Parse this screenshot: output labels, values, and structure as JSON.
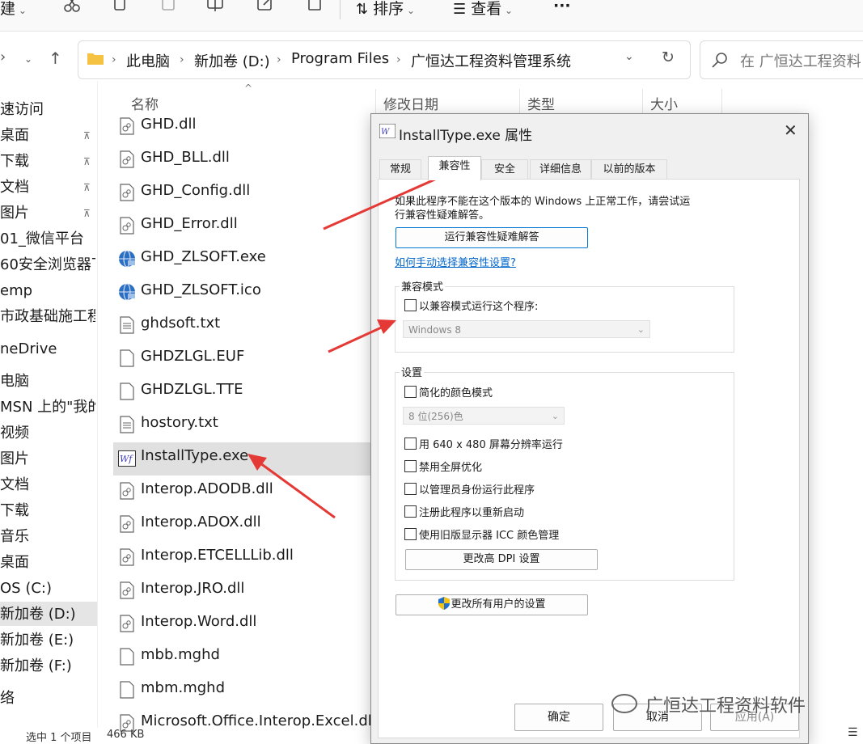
{
  "toolbar": {
    "new_label": "建",
    "sort_label": "排序",
    "view_label": "查看",
    "more_label": "···"
  },
  "address": {
    "crumbs": [
      "此电脑",
      "新加卷 (D:)",
      "Program Files",
      "广恒达工程资料管理系统"
    ],
    "search_placeholder": "在 广恒达工程资料"
  },
  "sidebar": {
    "items": [
      {
        "label": "速访问",
        "pinned": false
      },
      {
        "label": "桌面",
        "pinned": true
      },
      {
        "label": "下载",
        "pinned": true
      },
      {
        "label": "文档",
        "pinned": true
      },
      {
        "label": "图片",
        "pinned": true
      },
      {
        "label": "01_微信平台",
        "pinned": false
      },
      {
        "label": "60安全浏览器下",
        "pinned": false
      },
      {
        "label": "emp",
        "pinned": false
      },
      {
        "label": "市政基础施工程序",
        "pinned": false
      },
      {
        "label": "neDrive",
        "pinned": false
      },
      {
        "label": "电脑",
        "pinned": false
      },
      {
        "label": "MSN 上的\"我的图",
        "pinned": false
      },
      {
        "label": "视频",
        "pinned": false
      },
      {
        "label": "图片",
        "pinned": false
      },
      {
        "label": "文档",
        "pinned": false
      },
      {
        "label": "下载",
        "pinned": false
      },
      {
        "label": "音乐",
        "pinned": false
      },
      {
        "label": "桌面",
        "pinned": false
      },
      {
        "label": "OS (C:)",
        "pinned": false
      },
      {
        "label": "新加卷 (D:)",
        "pinned": false
      },
      {
        "label": "新加卷 (E:)",
        "pinned": false
      },
      {
        "label": "新加卷 (F:)",
        "pinned": false
      },
      {
        "label": "络",
        "pinned": false
      }
    ]
  },
  "columns": {
    "name": "名称",
    "modified": "修改日期",
    "type": "类型",
    "size": "大小"
  },
  "files": [
    {
      "name": "GHD.dll",
      "icon": "dll-icon"
    },
    {
      "name": "GHD_BLL.dll",
      "icon": "dll-icon"
    },
    {
      "name": "GHD_Config.dll",
      "icon": "dll-icon"
    },
    {
      "name": "GHD_Error.dll",
      "icon": "dll-icon"
    },
    {
      "name": "GHD_ZLSOFT.exe",
      "icon": "globe-icon"
    },
    {
      "name": "GHD_ZLSOFT.ico",
      "icon": "globe-icon"
    },
    {
      "name": "ghdsoft.txt",
      "icon": "txt-icon"
    },
    {
      "name": "GHDZLGL.EUF",
      "icon": "file-icon"
    },
    {
      "name": "GHDZLGL.TTE",
      "icon": "file-icon"
    },
    {
      "name": "hostory.txt",
      "icon": "txt-icon"
    },
    {
      "name": "InstallType.exe",
      "icon": "app-icon"
    },
    {
      "name": "Interop.ADODB.dll",
      "icon": "dll-icon"
    },
    {
      "name": "Interop.ADOX.dll",
      "icon": "dll-icon"
    },
    {
      "name": "Interop.ETCELLLib.dll",
      "icon": "dll-icon"
    },
    {
      "name": "Interop.JRO.dll",
      "icon": "dll-icon"
    },
    {
      "name": "Interop.Word.dll",
      "icon": "dll-icon"
    },
    {
      "name": "mbb.mghd",
      "icon": "file-icon"
    },
    {
      "name": "mbm.mghd",
      "icon": "file-icon"
    },
    {
      "name": "Microsoft.Office.Interop.Excel.dll",
      "icon": "dll-icon"
    }
  ],
  "status": {
    "selected": "选中 1 个项目",
    "size": "466 KB"
  },
  "dialog": {
    "title": "InstallType.exe 属性",
    "tabs": [
      "常规",
      "兼容性",
      "安全",
      "详细信息",
      "以前的版本"
    ],
    "active_tab": "兼容性",
    "intro_line1": "如果此程序不能在这个版本的 Windows 上正常工作，请尝试运",
    "intro_line2": "行兼容性疑难解答。",
    "troubleshoot_button": "运行兼容性疑难解答",
    "manual_link": "如何手动选择兼容性设置?",
    "compat_group": "兼容模式",
    "compat_checkbox": "以兼容模式运行这个程序:",
    "compat_select": "Windows 8",
    "settings_group": "设置",
    "reduced_color": "简化的颜色模式",
    "color_select": "8 位(256)色",
    "res_640": "用 640 x 480 屏幕分辨率运行",
    "disable_fullscreen": "禁用全屏优化",
    "run_admin": "以管理员身份运行此程序",
    "register_restart": "注册此程序以重新启动",
    "legacy_icc": "使用旧版显示器 ICC 颜色管理",
    "dpi_button": "更改高 DPI 设置",
    "all_users_button": "更改所有用户的设置",
    "ok_button": "确定",
    "cancel_button": "取消",
    "apply_button": "应用(A)"
  },
  "watermark": "广恒达工程资料软件",
  "colors": {
    "accent": "#0078d4",
    "arrow": "#e53935",
    "link": "#0066cc"
  }
}
